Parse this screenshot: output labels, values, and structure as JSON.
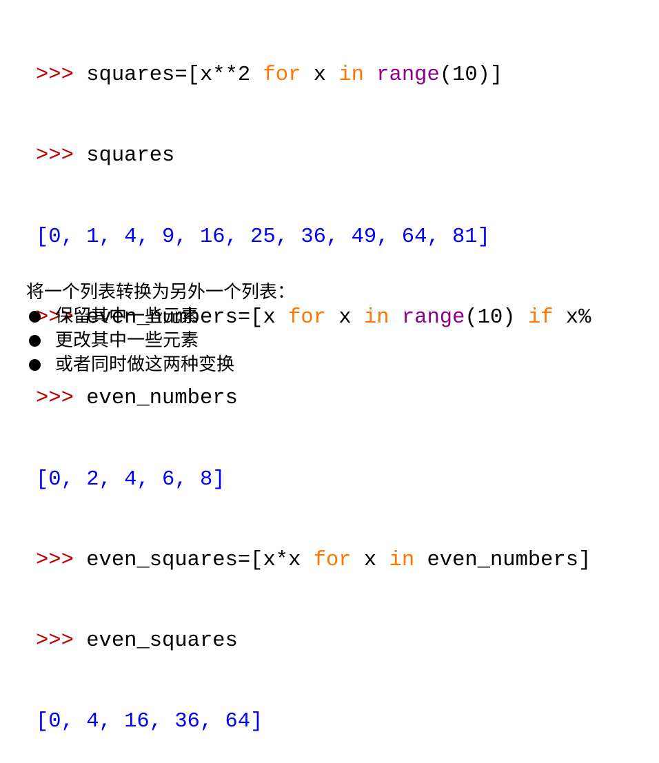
{
  "code": {
    "prompt": ">>>",
    "line1": {
      "a": "squares=[x**2 ",
      "for": "for",
      "b": " x ",
      "in": "in",
      "c": " ",
      "range": "range",
      "d": "(10)]"
    },
    "line2": {
      "a": "squares"
    },
    "line3": {
      "output": "[0, 1, 4, 9, 16, 25, 36, 49, 64, 81]"
    },
    "line4": {
      "a": "even_numbers=[x ",
      "for": "for",
      "b": " x ",
      "in": "in",
      "c": " ",
      "range": "range",
      "d": "(10) ",
      "if": "if",
      "e": " x%"
    },
    "line5": {
      "a": "even_numbers"
    },
    "line6": {
      "output": "[0, 2, 4, 6, 8]"
    },
    "line7": {
      "a": "even_squares=[x*x ",
      "for": "for",
      "b": " x ",
      "in": "in",
      "c": " even_numbers]"
    },
    "line8": {
      "a": "even_squares"
    },
    "line9": {
      "output": "[0, 4, 16, 36, 64]"
    }
  },
  "notes": {
    "heading": "将一个列表转换为另外一个列表：",
    "bullets": [
      "保留其中一些元素",
      "更改其中一些元素",
      "或者同时做这两种变换"
    ]
  }
}
